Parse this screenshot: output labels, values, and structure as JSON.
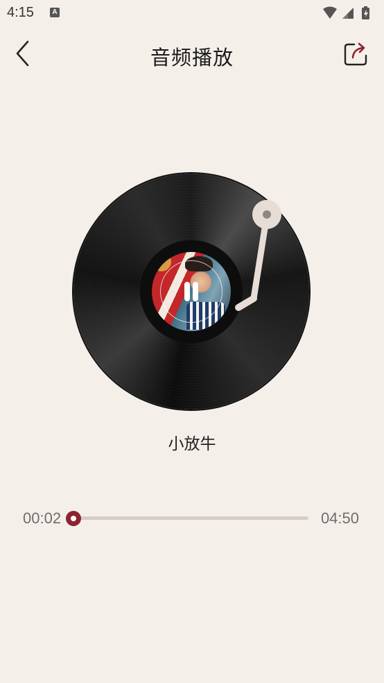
{
  "status_bar": {
    "time": "4:15",
    "notification_icon": "A"
  },
  "header": {
    "title": "音频播放",
    "back_icon": "chevron-left-icon",
    "share_icon": "share-icon"
  },
  "player": {
    "song_title": "小放牛",
    "current_time": "00:02",
    "total_time": "04:50",
    "progress": 0.007,
    "state_icon": "pause-icon"
  },
  "colors": {
    "background": "#f5efea",
    "accent": "#8b2332",
    "track": "#d6cdc8",
    "tonearm": "#e8ddd6"
  }
}
